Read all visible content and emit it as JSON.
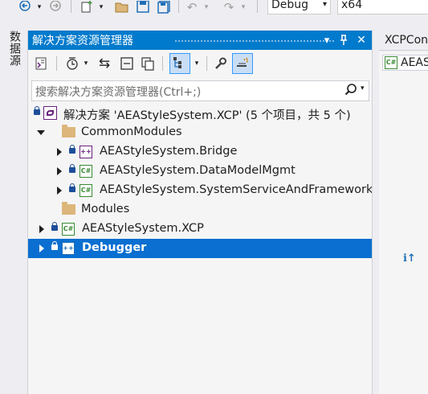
{
  "toolbar": {
    "config": "Debug",
    "platform": "x64"
  },
  "side_tab": {
    "label": "数据源"
  },
  "solution_explorer": {
    "title": "解决方案资源管理器",
    "title_buttons": [
      "▾",
      "📌",
      "✕"
    ],
    "search_placeholder": "搜索解决方案资源管理器(Ctrl+;)",
    "tree": {
      "solution": "解决方案 'AEAStyleSystem.XCP' (5 个项目，共 5 个)",
      "common_modules": "CommonModules",
      "bridge": "AEAStyleSystem.Bridge",
      "datamodel": "AEAStyleSystem.DataModelMgmt",
      "sysservice": "AEAStyleSystem.SystemServiceAndFramework",
      "modules": "Modules",
      "xcp": "AEAStyleSystem.XCP",
      "debugger": "Debugger"
    },
    "selected_item": "Debugger"
  },
  "right_panel": {
    "tab": "XCPCon",
    "doc": "AEAS"
  },
  "colors": {
    "accent": "#007acc",
    "selection": "#0a6fd0",
    "folder": "#dcb67a",
    "csharp": "#388a34",
    "cpp": "#68217a"
  },
  "icons": [
    "back-icon",
    "forward-icon",
    "new-item-icon",
    "open-folder-icon",
    "save-icon",
    "save-all-icon",
    "undo-icon",
    "redo-icon",
    "switch-views-icon",
    "history-icon",
    "sync-icon",
    "collapse-all-icon",
    "show-all-files-icon",
    "properties-icon",
    "preview-icon",
    "search-icon",
    "lock-icon",
    "folder-icon",
    "project-icon"
  ]
}
